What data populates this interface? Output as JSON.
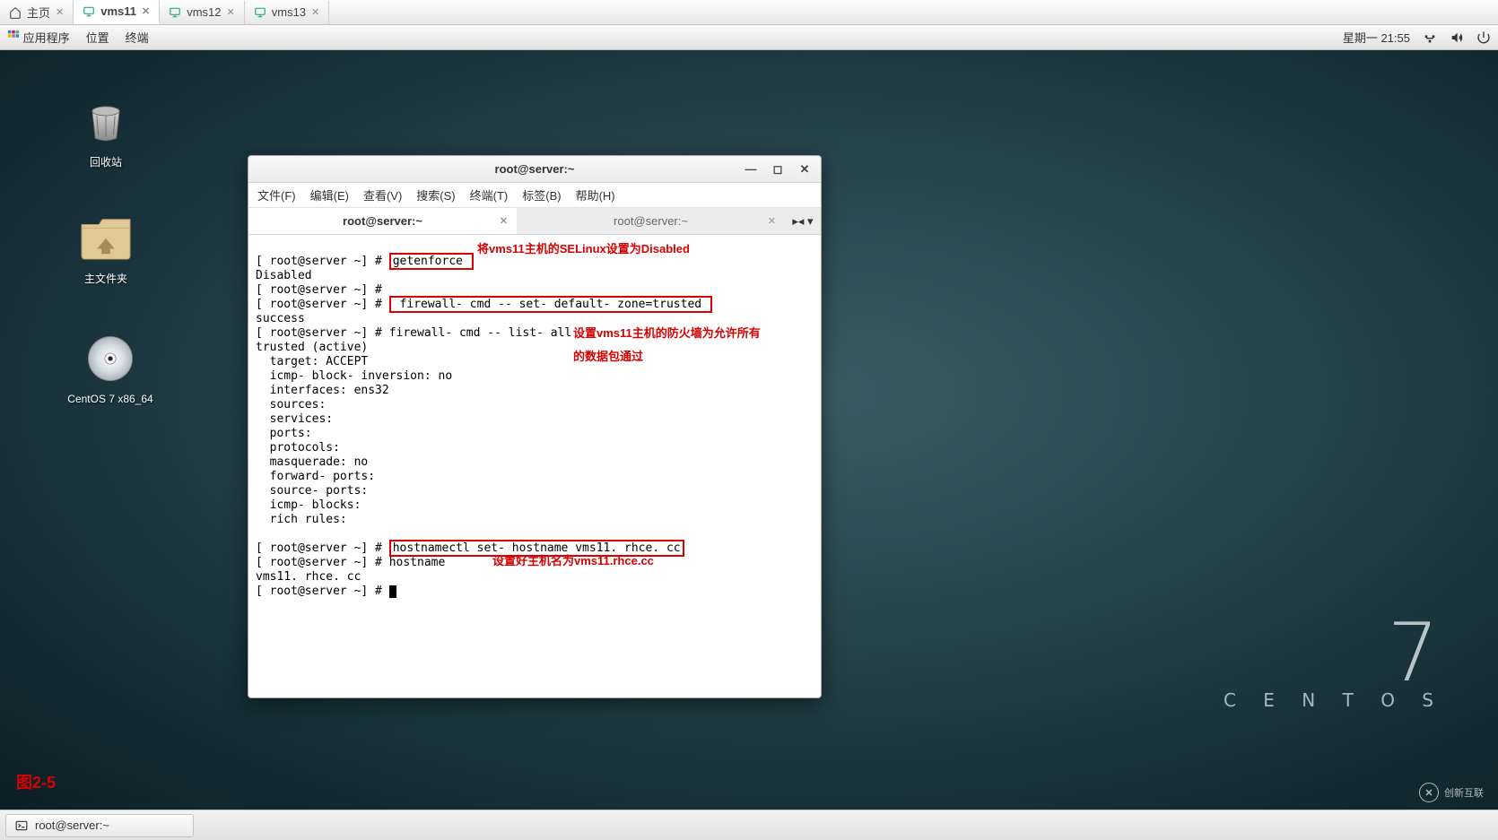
{
  "vm_tabs": {
    "home": "主页",
    "items": [
      {
        "label": "vms11",
        "active": true
      },
      {
        "label": "vms12",
        "active": false
      },
      {
        "label": "vms13",
        "active": false
      }
    ]
  },
  "gnome_panel": {
    "applications": "应用程序",
    "places": "位置",
    "terminal": "终端",
    "clock": "星期一 21:55"
  },
  "desktop_icons": {
    "trash": "回收站",
    "home": "主文件夹",
    "dvd": "CentOS 7 x86_64"
  },
  "centos_brand": {
    "seven": "7",
    "word": "C E N T O S"
  },
  "fig_label": "图2-5",
  "watermark": "创新互联",
  "taskbar": {
    "item0": "root@server:~"
  },
  "terminal": {
    "title": "root@server:~",
    "menu": {
      "file": "文件(F)",
      "edit": "编辑(E)",
      "view": "查看(V)",
      "search": "搜索(S)",
      "terminal_m": "终端(T)",
      "tabs_m": "标签(B)",
      "help": "帮助(H)"
    },
    "tabs": [
      {
        "label": "root@server:~",
        "active": true
      },
      {
        "label": "root@server:~",
        "active": false
      }
    ],
    "lines": {
      "l1a": "[ root@server ~] # ",
      "l1b": "getenforce ",
      "l2": "Disabled",
      "l3": "[ root@server ~] #",
      "l4a": "[ root@server ~] # ",
      "l4b": " firewall- cmd -- set- default- zone=trusted ",
      "l5": "success",
      "l6": "[ root@server ~] # firewall- cmd -- list- all",
      "l7": "trusted (active)",
      "l8": "  target: ACCEPT",
      "l9": "  icmp- block- inversion: no",
      "l10": "  interfaces: ens32",
      "l11": "  sources:",
      "l12": "  services:",
      "l13": "  ports:",
      "l14": "  protocols:",
      "l15": "  masquerade: no",
      "l16": "  forward- ports:",
      "l17": "  source- ports:",
      "l18": "  icmp- blocks:",
      "l19": "  rich rules:",
      "blank": "",
      "l20a": "[ root@server ~] # ",
      "l20b": "hostnamectl set- hostname vms11. rhce. cc",
      "l21": "[ root@server ~] # hostname",
      "l22": "vms11. rhce. cc",
      "l23": "[ root@server ~] # "
    },
    "annotations": {
      "a1": "将vms11主机的SELinux设置为Disabled",
      "a2a": "设置vms11主机的防火墙为允许所有",
      "a2b": "的数据包通过",
      "a3": "设置好主机名为vms11.rhce.cc"
    }
  }
}
